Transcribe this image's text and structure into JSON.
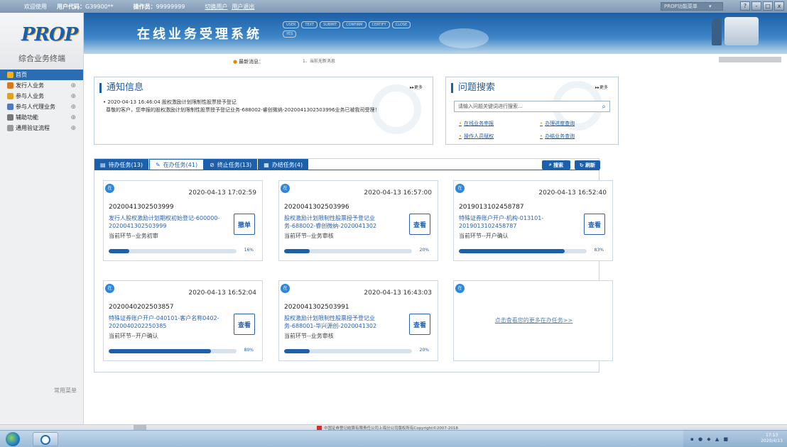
{
  "topbar": {
    "welcome": "欢迎使用",
    "user_code_label": "用户代码：",
    "user_code_value": "G39900**",
    "operator_label": "操作员：",
    "operator_value": "99999999",
    "switch_user": "切换用户",
    "logout": "用户退出",
    "select_text": "PROP功能菜单",
    "win_buttons": [
      "?",
      "-",
      "□",
      "x"
    ]
  },
  "sidebar": {
    "logo_text": "PROP",
    "app_name": "综合业务终端",
    "items": [
      {
        "label": "首页",
        "icon": "home-icon",
        "color": "#f3b21c",
        "active": true
      },
      {
        "label": "发行人业务",
        "icon": "user-icon",
        "color": "#d77a1e",
        "plus": "⊕"
      },
      {
        "label": "参与人业务",
        "icon": "people-icon",
        "color": "#e0a020",
        "plus": "⊕"
      },
      {
        "label": "参与人代理业务",
        "icon": "list-icon",
        "color": "#5077c0",
        "plus": "⊕"
      },
      {
        "label": "辅助功能",
        "icon": "tools-icon",
        "color": "#777777",
        "plus": "⊕"
      },
      {
        "label": "通用验证流程",
        "icon": "folder-icon",
        "color": "#999999",
        "plus": "⊕"
      }
    ],
    "common_menu": "常用菜单"
  },
  "header": {
    "title": "在线业务受理系统",
    "flow_steps": [
      "USER",
      "TEXT",
      "SUBMIT",
      "CONFIRM",
      "CERTIFY",
      "CLOSE",
      "YES"
    ]
  },
  "newsbar": {
    "label": "最新消息：",
    "text": "1、当前无新消息"
  },
  "notice": {
    "title": "通知信息",
    "more": "更多",
    "line1": "2020-04-13 16:46:04 股权激励计划限制性股票授予登记",
    "line2": "尊敬的客户，您申报的股权激励计划限制性股票授予登记业务-688002-睿创微纳-2020041302503996业务已被我司受理！"
  },
  "question": {
    "title": "问题搜索",
    "more": "更多",
    "placeholder": "请输入问题关键词进行搜索...",
    "links": [
      "在线业务申报",
      "办理进度查询",
      "操作人员赋权",
      "办结业务查询"
    ]
  },
  "tabs": [
    {
      "label": "待办任务(13)",
      "icon": "clipboard-icon",
      "glyph": "▤"
    },
    {
      "label": "在办任务(41)",
      "icon": "pencil-icon",
      "glyph": "✎",
      "active": true
    },
    {
      "label": "终止任务(13)",
      "icon": "ban-icon",
      "glyph": "⊘"
    },
    {
      "label": "办结任务(4)",
      "icon": "chart-icon",
      "glyph": "▦"
    }
  ],
  "actions": {
    "search": "搜索",
    "refresh": "刷新"
  },
  "cards": [
    {
      "tag": "在",
      "date": "2020-04-13 17:02:59",
      "code": "2020041302503999",
      "name": "发行人股权激励计划期权初始登记-600000-2020041302503999",
      "step": "当前环节--业务初审",
      "action": "撤单",
      "progress": 16,
      "pct": "16%"
    },
    {
      "tag": "在",
      "date": "2020-04-13 16:57:00",
      "code": "2020041302503996",
      "name": "股权激励计划限制性股票授予登记业务-688002-睿创微纳-2020041302",
      "step": "当前环节--业务审核",
      "action": "查看",
      "progress": 20,
      "pct": "20%"
    },
    {
      "tag": "在",
      "date": "2020-04-13 16:52:40",
      "code": "2019013102458787",
      "name": "特殊证券账户开户-机构-013101-2019013102458787",
      "step": "当前环节--开户确认",
      "action": "查看",
      "progress": 83,
      "pct": "83%"
    },
    {
      "tag": "在",
      "date": "2020-04-13 16:52:04",
      "code": "2020040202503857",
      "name": "特殊证券账户开户-040101-客户名称0402-2020040202250385",
      "step": "当前环节--开户确认",
      "action": "查看",
      "progress": 80,
      "pct": "80%"
    },
    {
      "tag": "在",
      "date": "2020-04-13 16:43:03",
      "code": "2020041302503991",
      "name": "股权激励计划限制性股票授予登记业务-688001-华兴源创-2020041302",
      "step": "当前环节--业务审核",
      "action": "查看",
      "progress": 20,
      "pct": "20%"
    }
  ],
  "more_card": {
    "tag": "在",
    "text": "点击查看您的更多在办任务>>"
  },
  "footer": {
    "text": "中国证券登记结算有限责任公司上海分公司版权所有Copyright©2007-2018"
  },
  "taskbar": {
    "time": "17:13",
    "date": "2020/4/13"
  }
}
